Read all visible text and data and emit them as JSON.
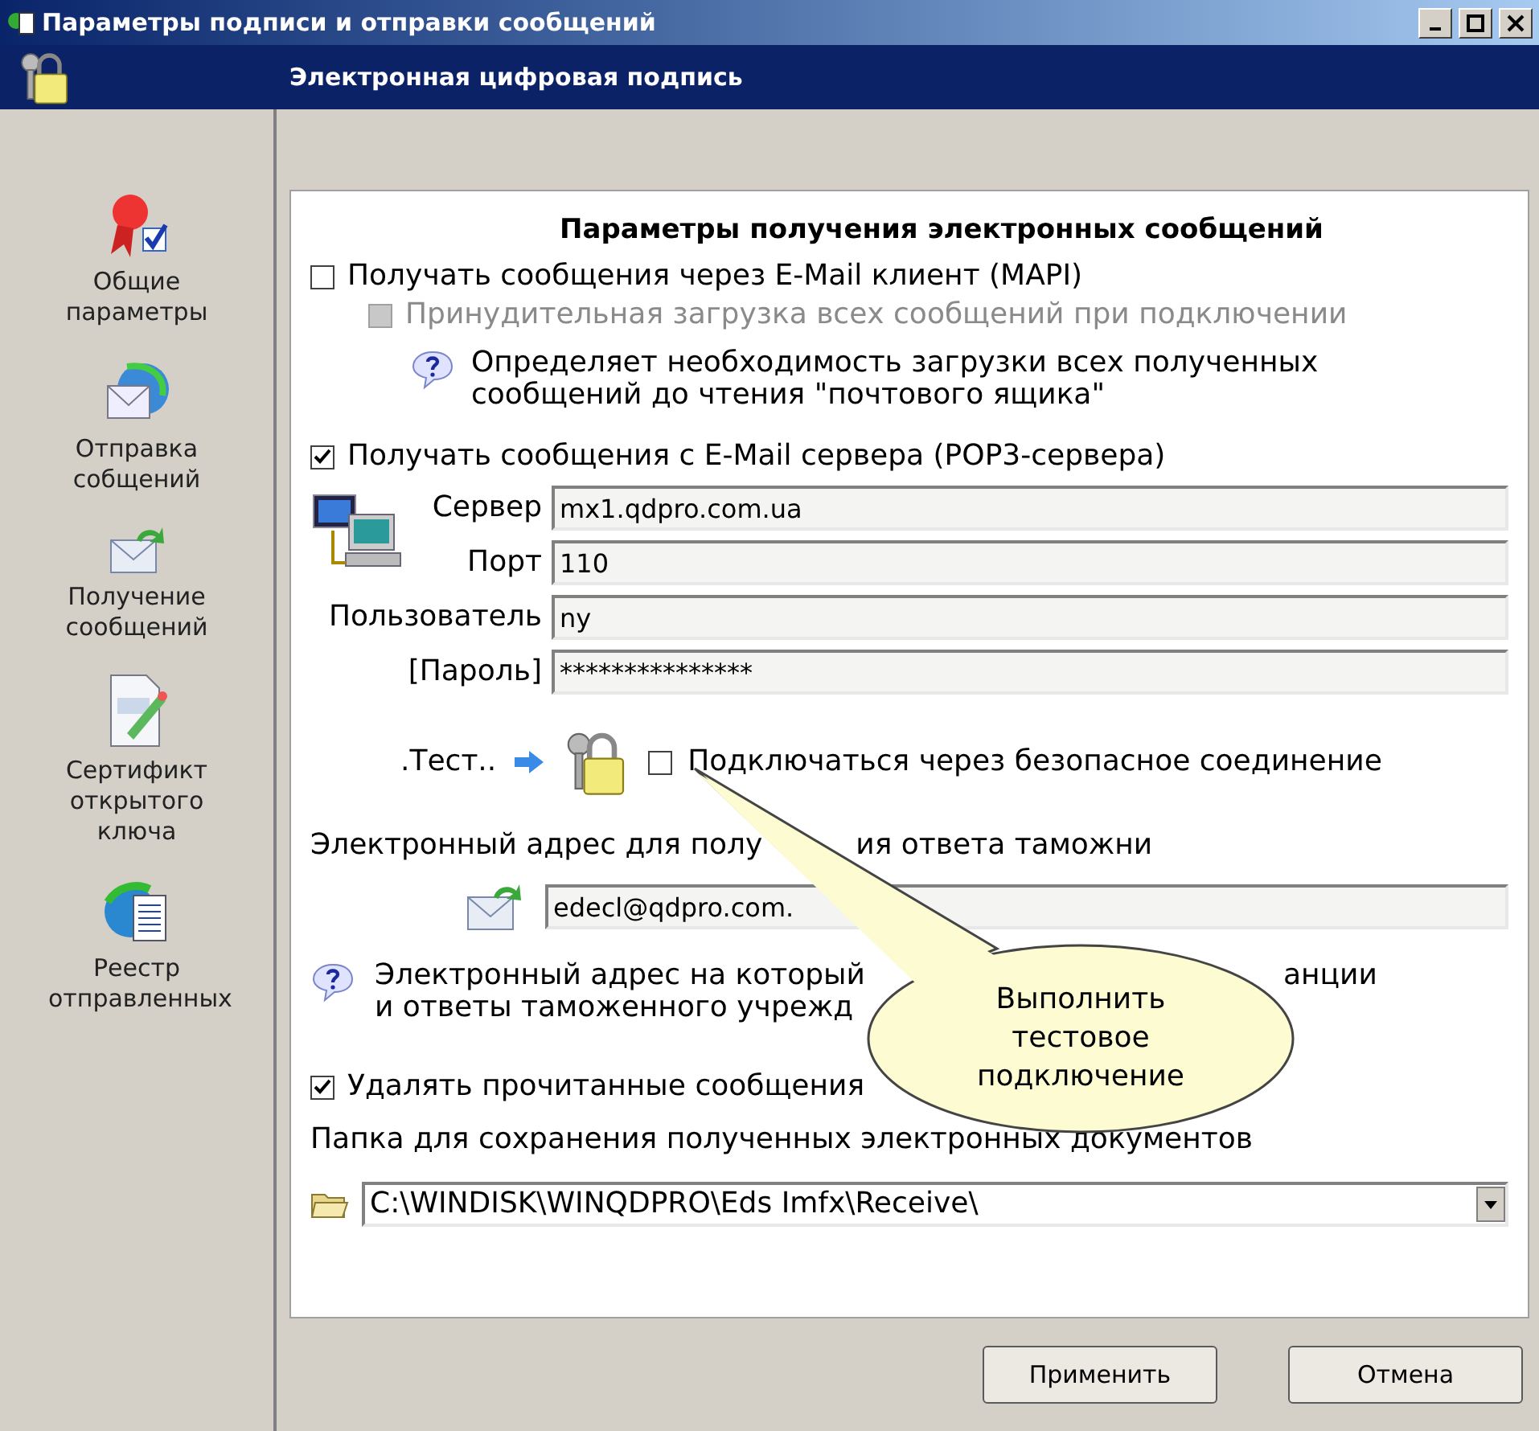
{
  "window": {
    "title": "Параметры подписи и отправки сообщений"
  },
  "header": {
    "title": "Электронная цифровая подпись"
  },
  "sidebar": {
    "items": [
      {
        "label": "Общие параметры"
      },
      {
        "label": "Отправка собщений"
      },
      {
        "label": "Получение сообщений"
      },
      {
        "label": "Сертификт открытого ключа"
      },
      {
        "label": "Реестр отправленных"
      }
    ]
  },
  "section_title": "Параметры получения электронных сообщений",
  "mapi": {
    "label": "Получать сообщения через E-Mail клиент (MAPI)",
    "checked": false
  },
  "force_load": {
    "label": "Принудительная загрузка всех сообщений при подключении",
    "checked": false,
    "disabled": true
  },
  "mapi_hint": "Определяет необходимость загрузки всех полученных\nсообщений до чтения \"почтового ящика\"",
  "pop3": {
    "label": "Получать сообщения с E-Mail сервера (POP3-сервера)",
    "checked": true
  },
  "fields": [
    {
      "label": "Сервер",
      "value": "mx1.qdpro.com.ua"
    },
    {
      "label": "Порт",
      "value": "110"
    },
    {
      "label": "Пользователь",
      "value": "ny"
    },
    {
      "label": "[Пароль]",
      "value": "***************"
    }
  ],
  "test": {
    "label": ".Тест.."
  },
  "secure": {
    "label": "Подключаться через безопасное соединение",
    "checked": false
  },
  "reply_address": {
    "label_parts": [
      "Электронный адрес для полу",
      "ия ответа таможни"
    ],
    "value": "edecl@qdpro.com."
  },
  "reply_hint": {
    "line_1": [
      "Электронный адрес на который",
      "анции"
    ],
    "line_2": "и ответы таможенного учрежд"
  },
  "delete_read": {
    "label": "Удалять прочитанные сообщения",
    "checked": true
  },
  "folder": {
    "label": "Папка для сохранения полученных электронных документов",
    "value": "C:\\WINDISK\\WINQDPRO\\Eds Imfx\\Receive\\"
  },
  "balloon": {
    "text": "Выполнить\nтестовое\nподключение"
  },
  "buttons": [
    {
      "label": "Применить"
    },
    {
      "label": "Отмена"
    }
  ]
}
